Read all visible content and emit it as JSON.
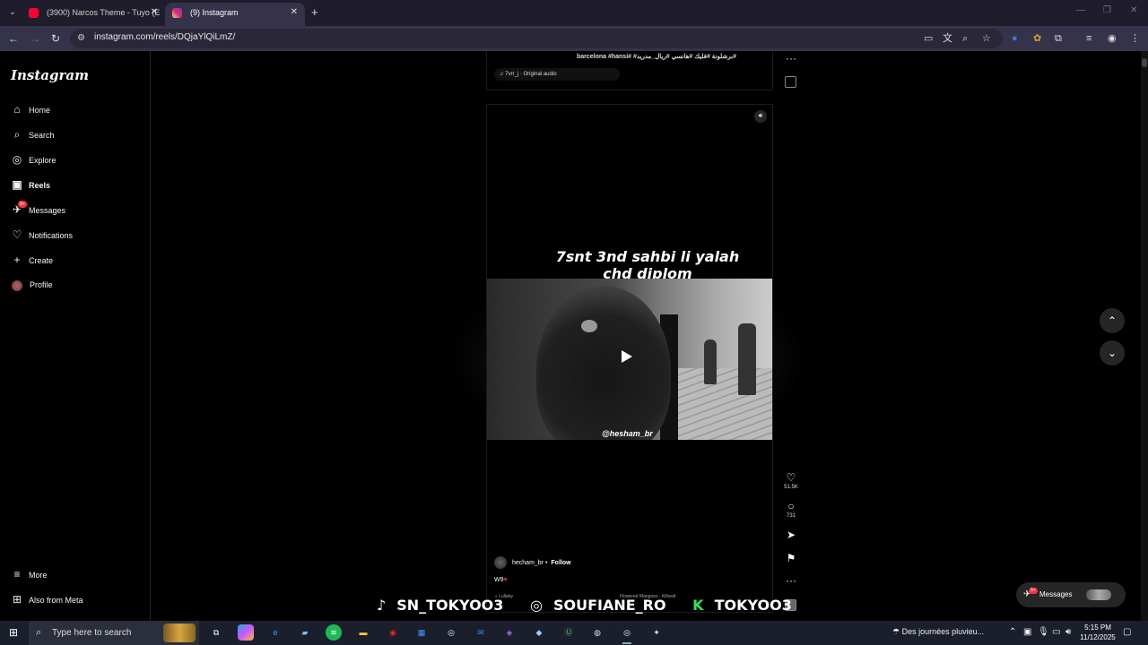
{
  "browser": {
    "tabs": [
      {
        "label": "(3900) Narcos Theme - Tuyo (E",
        "active": false
      },
      {
        "label": "(9) Instagram",
        "active": true
      }
    ],
    "new_tab": "+",
    "url": "instagram.com/reels/DQjaYlQiLmZ/",
    "icons": [
      "back-icon",
      "forward-icon",
      "reload-icon",
      "site-info-icon",
      "cast-icon",
      "translate-icon",
      "zoom-icon",
      "star-icon",
      "extensions-icon",
      "profile-icon",
      "menu-icon"
    ]
  },
  "sidebar": {
    "logo": "Instagram",
    "items": [
      {
        "label": "Home",
        "icon": "home-icon"
      },
      {
        "label": "Search",
        "icon": "search-icon"
      },
      {
        "label": "Explore",
        "icon": "compass-icon"
      },
      {
        "label": "Reels",
        "icon": "reels-icon",
        "active": true
      },
      {
        "label": "Messages",
        "icon": "messenger-icon",
        "badge": "9+"
      },
      {
        "label": "Notifications",
        "icon": "heart-icon"
      },
      {
        "label": "Create",
        "icon": "plus-icon"
      },
      {
        "label": "Profile",
        "icon": "avatar"
      }
    ],
    "more": "More",
    "also_from_meta": "Also from Meta"
  },
  "previous_reel": {
    "caption": "barcelona #hansi# #برشلونة #فليك #هانسي #ريال_مدريد#",
    "audio": "7vrr_j · Original audio"
  },
  "reel": {
    "overlay_text_line1": "7snt 3nd sahbi li yalah",
    "overlay_text_line2": "chd diplom",
    "watermark": "@hesham_br",
    "author": "hecham_br",
    "separator": "•",
    "follow": "Follow",
    "caption": "W9",
    "caption_emoji": "♥",
    "audio_left": "Lullaby",
    "audio_right": "Flowered Mangoes · Killswit"
  },
  "actions": {
    "likes": "51.5K",
    "comments": "731"
  },
  "messages_pill": {
    "label": "Messages",
    "badge": "9+"
  },
  "stream_overlay": {
    "tiktok": "SN_TOKYOO3",
    "instagram": "SOUFIANE_RO",
    "kick_prefix": "K",
    "kick": "TOKYOO3"
  },
  "taskbar": {
    "search_placeholder": "Type here to search",
    "weather": "Des journées pluvieu...",
    "time": "5:15 PM",
    "date": "11/12/2025"
  }
}
